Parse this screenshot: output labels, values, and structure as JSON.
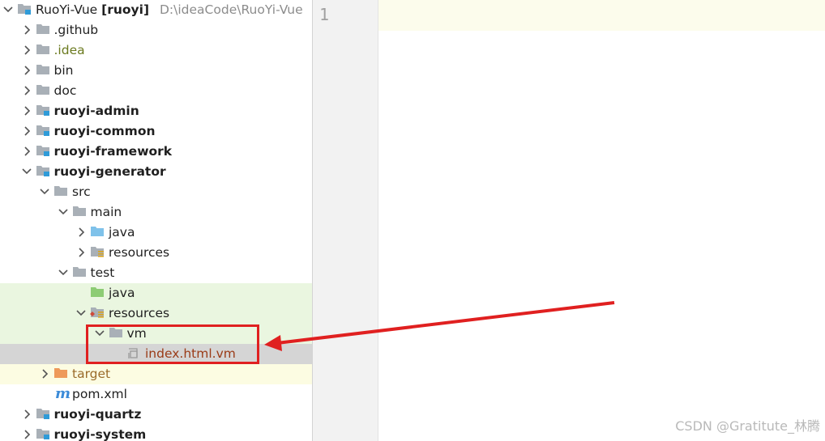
{
  "project": {
    "name": "RuoYi-Vue",
    "module_tag": "[ruoyi]",
    "path": "D:\\ideaCode\\RuoYi-Vue"
  },
  "tree": [
    {
      "id": "github",
      "label": ".github",
      "icon": "folder-icon",
      "arrow": "right"
    },
    {
      "id": "idea",
      "label": ".idea",
      "icon": "folder-icon",
      "arrow": "right"
    },
    {
      "id": "bin",
      "label": "bin",
      "icon": "folder-icon",
      "arrow": "right"
    },
    {
      "id": "doc",
      "label": "doc",
      "icon": "folder-icon",
      "arrow": "right"
    },
    {
      "id": "ruoyi-admin",
      "label": "ruoyi-admin",
      "icon": "module-folder-icon",
      "arrow": "right"
    },
    {
      "id": "ruoyi-common",
      "label": "ruoyi-common",
      "icon": "module-folder-icon",
      "arrow": "right"
    },
    {
      "id": "ruoyi-framework",
      "label": "ruoyi-framework",
      "icon": "module-folder-icon",
      "arrow": "right"
    },
    {
      "id": "ruoyi-generator",
      "label": "ruoyi-generator",
      "icon": "module-folder-icon",
      "arrow": "down"
    },
    {
      "id": "src",
      "label": "src",
      "icon": "folder-icon",
      "arrow": "down"
    },
    {
      "id": "main",
      "label": "main",
      "icon": "folder-icon",
      "arrow": "down"
    },
    {
      "id": "main-java",
      "label": "java",
      "icon": "source-folder-icon",
      "arrow": "right"
    },
    {
      "id": "main-resources",
      "label": "resources",
      "icon": "resources-folder-icon",
      "arrow": "right"
    },
    {
      "id": "test",
      "label": "test",
      "icon": "folder-icon",
      "arrow": "down"
    },
    {
      "id": "test-java",
      "label": "java",
      "icon": "test-source-folder-icon",
      "arrow": "none"
    },
    {
      "id": "test-resources",
      "label": "resources",
      "icon": "test-resources-folder-icon",
      "arrow": "down"
    },
    {
      "id": "vm",
      "label": "vm",
      "icon": "folder-icon",
      "arrow": "down"
    },
    {
      "id": "index-html-vm",
      "label": "index.html.vm",
      "icon": "template-file-icon",
      "arrow": "none"
    },
    {
      "id": "target",
      "label": "target",
      "icon": "excluded-folder-icon",
      "arrow": "right"
    },
    {
      "id": "pom-xml",
      "label": "pom.xml",
      "icon": "maven-icon",
      "arrow": "none"
    },
    {
      "id": "ruoyi-quartz",
      "label": "ruoyi-quartz",
      "icon": "module-folder-icon",
      "arrow": "right"
    },
    {
      "id": "ruoyi-system",
      "label": "ruoyi-system",
      "icon": "module-folder-icon",
      "arrow": "right"
    }
  ],
  "editor": {
    "line_number": "1"
  },
  "watermark": "CSDN @Gratitute_林腾",
  "colors": {
    "annotation": "#e02020",
    "selected_row": "#d5d5d5",
    "test_row": "#eaf6e0",
    "excluded_row": "#fcfce2",
    "folder": "#a9b0b7",
    "source_folder": "#7fc2ea",
    "test_source_folder": "#8dcc74",
    "excluded_folder": "#ee9a5a",
    "module_badge": "#2f9bd8"
  }
}
